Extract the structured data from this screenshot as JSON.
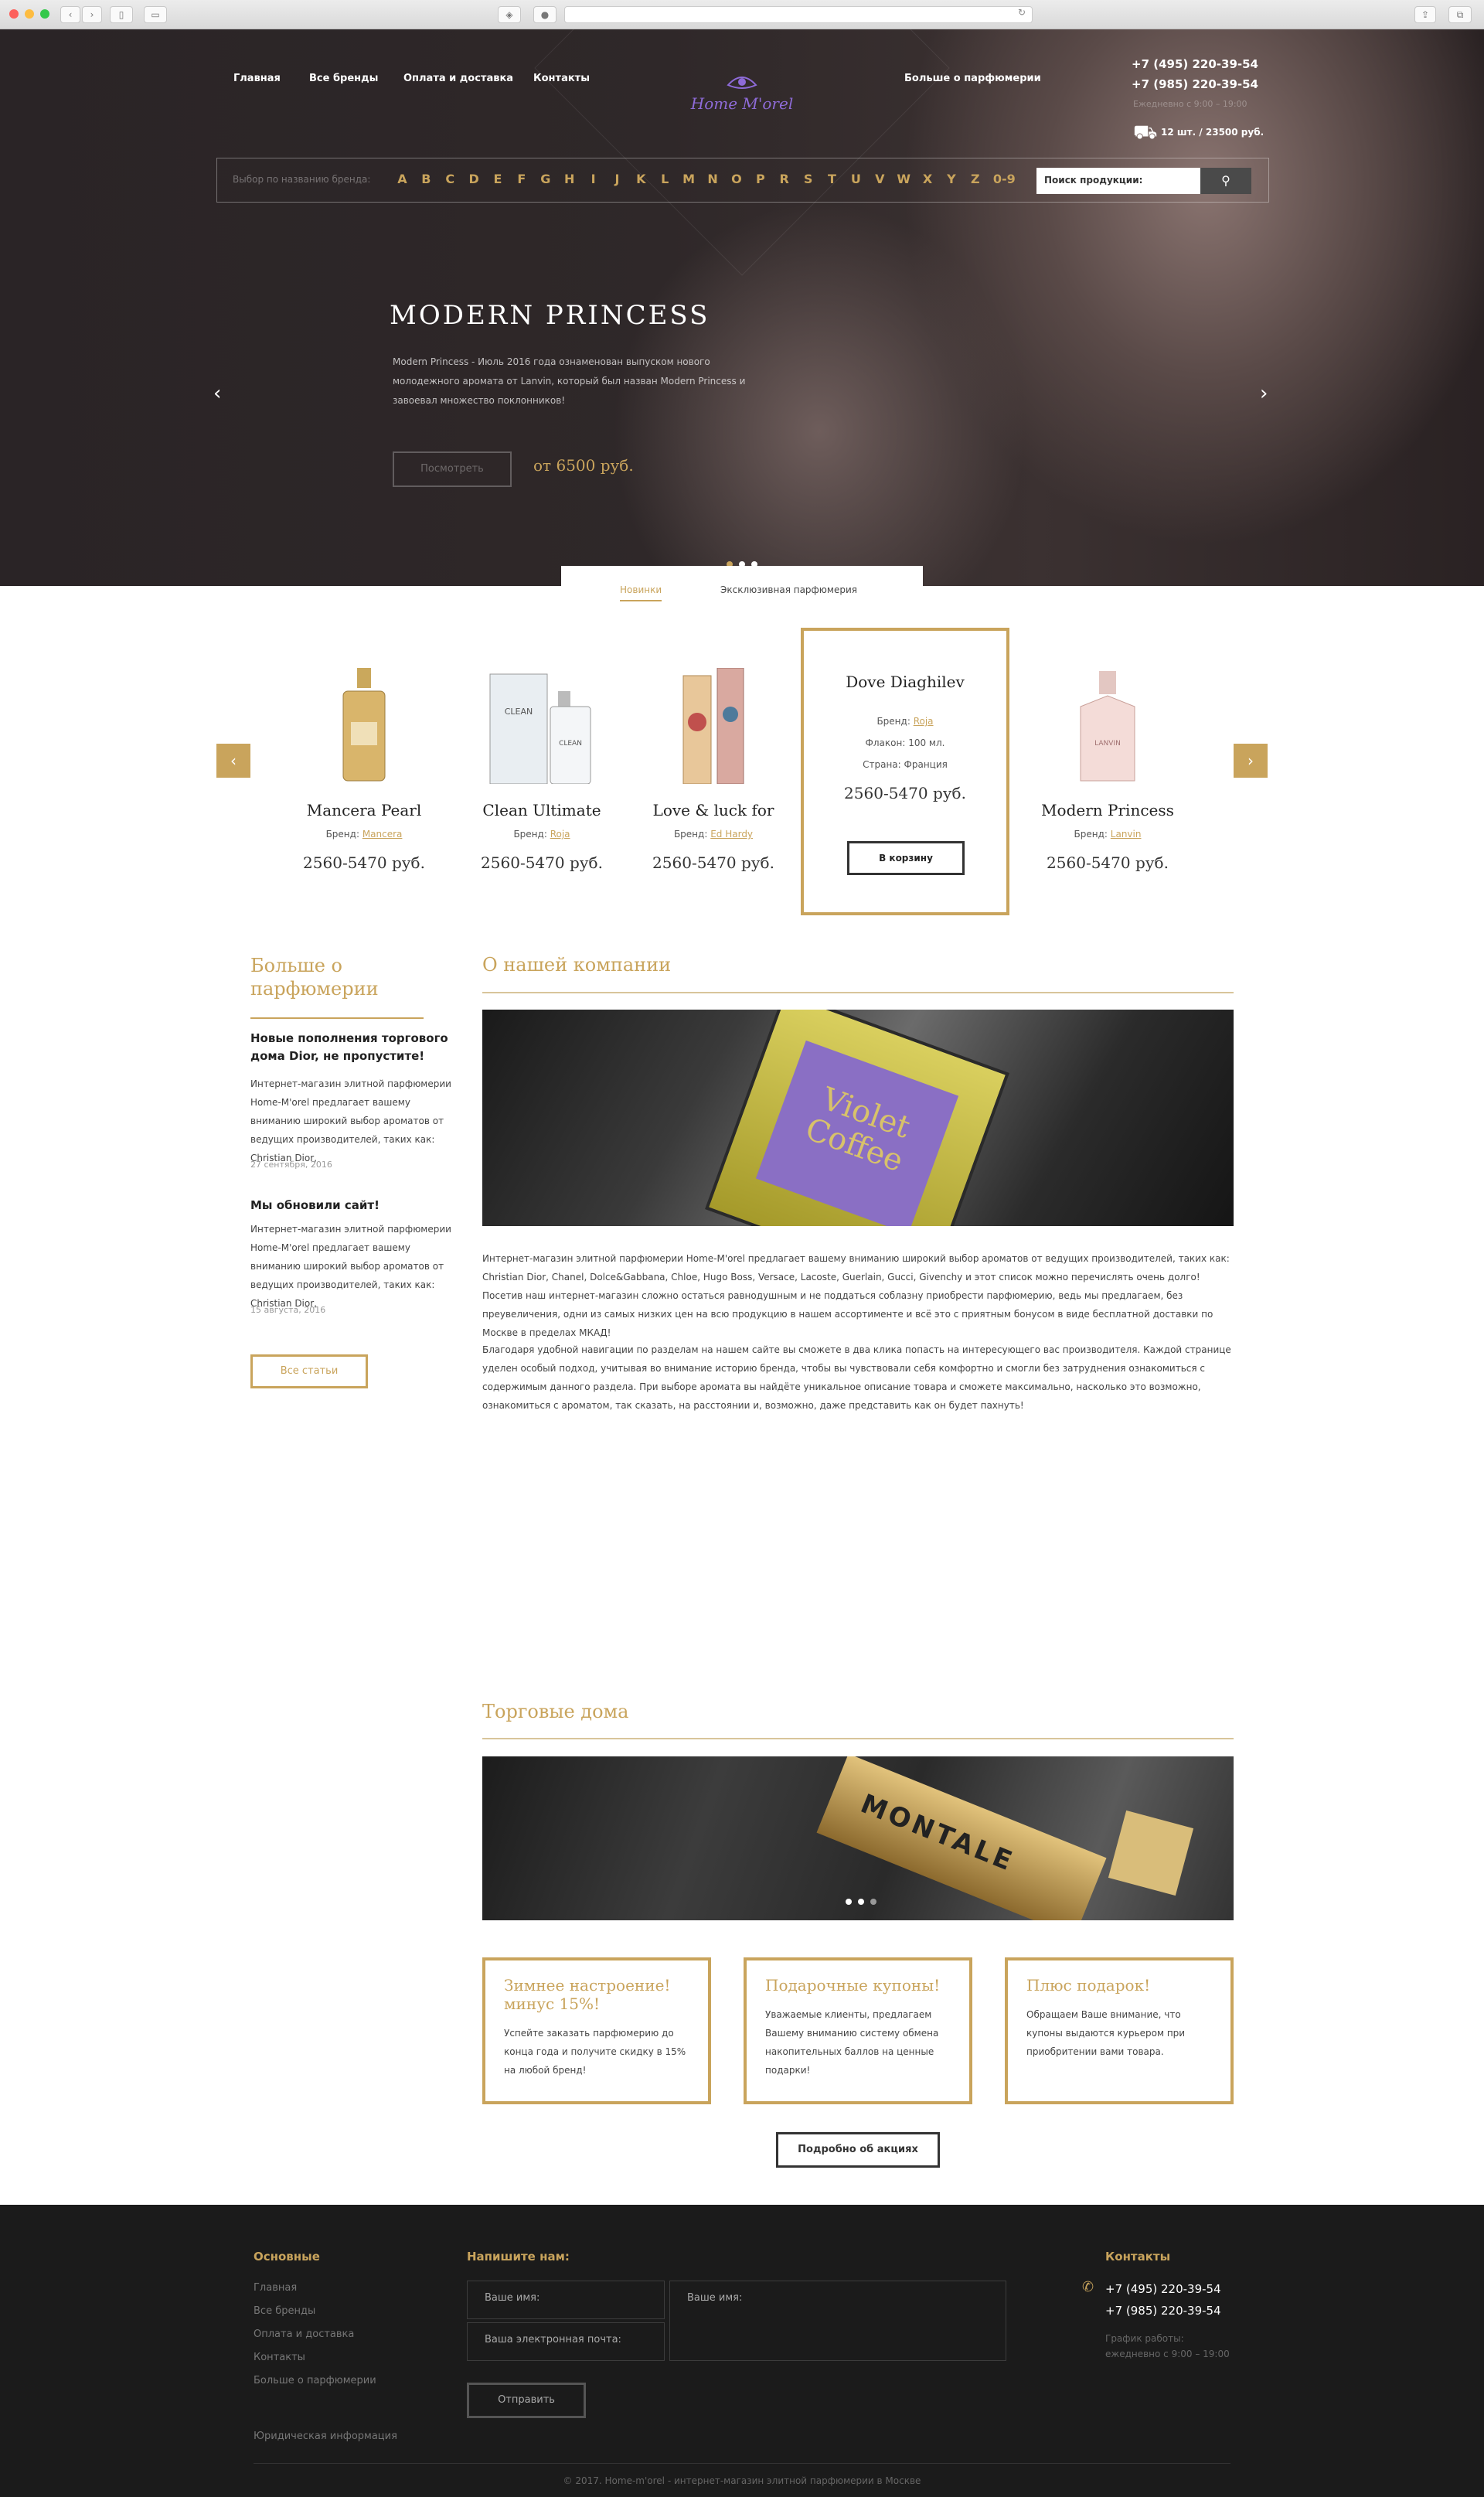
{
  "nav": {
    "items": [
      "Главная",
      "Все бренды",
      "Оплата и доставка",
      "Контакты"
    ],
    "more": "Больше о парфюмерии"
  },
  "logo": {
    "text": "Home M'orel"
  },
  "contacts": {
    "phone1": "+7 (495) 220-39-54",
    "phone2": "+7 (985) 220-39-54",
    "schedule": "Ежедневно с 9:00 – 19:00",
    "cart": "12 шт. / 23500 руб."
  },
  "alpha": {
    "hint": "Выбор по названию бренда:",
    "letters": [
      "A",
      "B",
      "C",
      "D",
      "E",
      "F",
      "G",
      "H",
      "I",
      "J",
      "K",
      "L",
      "M",
      "N",
      "O",
      "P",
      "R",
      "S",
      "T",
      "U",
      "V",
      "W",
      "X",
      "Y",
      "Z",
      "0-9"
    ],
    "search_placeholder": "Поиск продукции:"
  },
  "slide": {
    "title": "MODERN PRINCESS",
    "text": "Modern Princess - Июль 2016 года ознаменован выпуском нового молодежного аромата от Lanvin, который был назван Modern Princess и завоевал множество поклонников!",
    "button": "Посмотреть",
    "price": "от 6500 руб."
  },
  "tabs": {
    "new": "Новинки",
    "exclusive": "Эксклюзивная парфюмерия"
  },
  "products": [
    {
      "name": "Mancera Pearl",
      "brand_label": "Бренд:",
      "brand": "Mancera",
      "price": "2560-5470 руб."
    },
    {
      "name": "Clean Ultimate",
      "brand_label": "Бренд:",
      "brand": "Roja",
      "price": "2560-5470 руб."
    },
    {
      "name": "Love & luck for",
      "brand_label": "Бренд:",
      "brand": "Ed Hardy",
      "price": "2560-5470 руб."
    },
    {
      "name": "Modern Princess",
      "brand_label": "Бренд:",
      "brand": "Lanvin",
      "price": "2560-5470 руб."
    }
  ],
  "featured": {
    "name": "Dove Diaghilev",
    "brand_label": "Бренд:",
    "brand": "Roja",
    "volume": "Флакон: 100 мл.",
    "country": "Страна: Франция",
    "price": "2560-5470 руб.",
    "button": "В корзину"
  },
  "sidebar": {
    "title": "Больше о парфюмерии",
    "news": [
      {
        "title": "Новые пополнения торгового дома Dior, не пропустите!",
        "text": "Интернет-магазин элитной парфюмерии Home-M'orel предлагает вашему вниманию широкий выбор ароматов от ведущих производителей, таких как: Christian Dior,",
        "date": "27 сентября, 2016"
      },
      {
        "title": "Мы обновили сайт!",
        "text": "Интернет-магазин элитной парфюмерии Home-M'orel предлагает вашему вниманию широкий выбор ароматов от ведущих производителей, таких как: Christian Dior,",
        "date": "15 августа, 2016"
      }
    ],
    "all_button": "Все статьи"
  },
  "about": {
    "title": "О нашей компании",
    "image_label": "Violet Coffee",
    "p1": "Интернет-магазин элитной парфюмерии Home-M'orel предлагает вашему вниманию широкий выбор ароматов от ведущих производителей, таких как: Christian Dior, Chanel, Dolce&Gabbana, Chloe, Hugo Boss, Versace, Lacoste, Guerlain, Gucci, Givenchy и этот список можно перечислять очень долго! Посетив наш интернет-магазин сложно остаться равнодушным и не поддаться соблазну приобрести парфюмерию, ведь мы предлагаем, без преувеличения, одни из самых низких цен на всю продукцию в нашем ассортименте и всё это с приятным бонусом в виде бесплатной доставки по Москве в пределах МКАД!",
    "p2": "Благодаря удобной навигации по разделам на нашем сайте вы сможете в два клика попасть на интересующего вас производителя. Каждой странице уделен особый подход, учитывая во внимание историю бренда, чтобы вы чувствовали себя комфортно и смогли без затруднения ознакомиться с содержимым данного раздела. При выборе аромата вы найдёте уникальное описание товара и сможете максимально, насколько это возможно, ознакомиться с ароматом, так сказать, на расстоянии и, возможно, даже представить как он будет пахнуть!"
  },
  "houses": {
    "title": "Торговые дома",
    "image_label": "MONTALE"
  },
  "promos": [
    {
      "title": "Зимнее настроение! минус 15%!",
      "text": "Успейте заказать парфюмерию до конца года и получите скидку в 15% на любой бренд!"
    },
    {
      "title": "Подарочные купоны!",
      "text": "Уважаемые клиенты, предлагаем Вашему вниманию систему обмена накопительных баллов на ценные подарки!"
    },
    {
      "title": "Плюс подарок!",
      "text": "Обращаем Ваше внимание, что купоны выдаются курьером при приобритении вами товара."
    }
  ],
  "promo_button": "Подробно об акциях",
  "footer": {
    "main_title": "Основные",
    "links": [
      "Главная",
      "Все бренды",
      "Оплата и доставка",
      "Контакты",
      "Больше о парфюмерии"
    ],
    "legal": "Юридическая информация",
    "write_title": "Напишите нам:",
    "name_placeholder": "Ваше имя:",
    "email_placeholder": "Ваша электронная почта:",
    "message_placeholder": "Ваше имя:",
    "send": "Отправить",
    "contacts_title": "Контакты",
    "phone1": "+7 (495) 220-39-54",
    "phone2": "+7 (985) 220-39-54",
    "schedule_label": "График работы:",
    "schedule": "ежедневно с 9:00 – 19:00",
    "copyright": "© 2017. Home-m'orel - интернет-магазин элитной парфюмерии в Москве"
  },
  "colors": {
    "accent": "#c9a45c",
    "dark": "#1b1b1b",
    "hero": "#2f2829"
  }
}
